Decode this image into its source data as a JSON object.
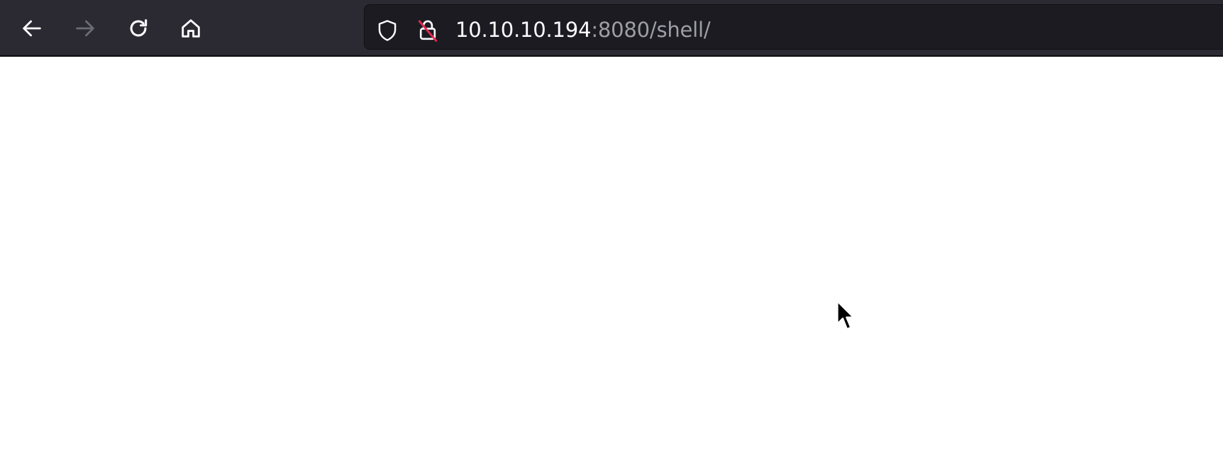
{
  "browser": {
    "nav": {
      "back_label": "Back",
      "forward_label": "Forward",
      "reload_label": "Reload",
      "home_label": "Home"
    },
    "urlbar": {
      "host": "10.10.10.194",
      "rest": ":8080/shell/",
      "shield_icon": "shield-icon",
      "insecure_lock_icon": "lock-slash-icon"
    }
  },
  "page": {
    "background": "#ffffff"
  },
  "colors": {
    "toolbar_bg": "#2b2a33",
    "urlbar_bg": "#1c1b22",
    "url_host": "#fbfbfe",
    "url_rest": "#9e9ea6",
    "icon_active": "#fbfbfe",
    "icon_disabled": "#6b6b73",
    "insecure_strike": "#e22850"
  }
}
